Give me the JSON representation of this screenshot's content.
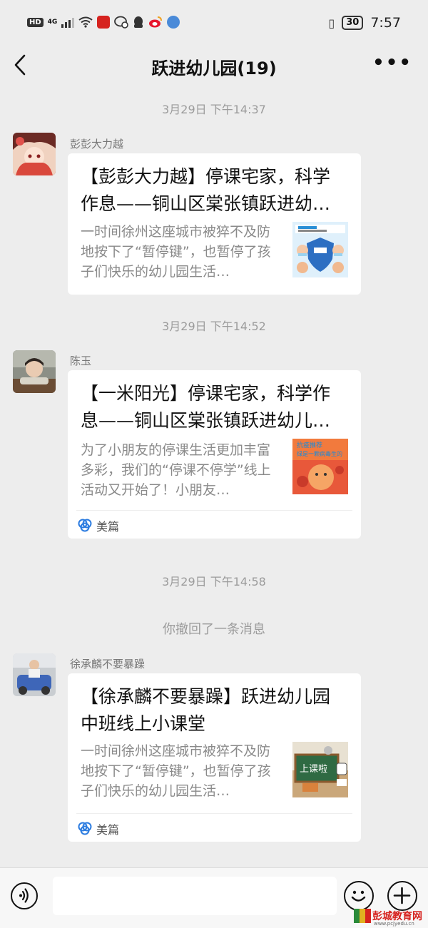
{
  "status_bar": {
    "hd": "HD",
    "network": "4G",
    "battery": "30",
    "time": "7:57"
  },
  "nav": {
    "title": "跃进幼儿园(19)",
    "more": "•••"
  },
  "timestamps": [
    "3月29日 下午14:37",
    "3月29日 下午14:52",
    "3月29日 下午14:58"
  ],
  "recall_notice": "你撤回了一条消息",
  "messages": [
    {
      "sender": "彭彭大力越",
      "title": "【彭彭大力越】停课宅家，科学作息——铜山区棠张镇跃进幼…",
      "desc": "一时间徐州这座城市被猝不及防地按下了“暂停键”，也暂停了孩子们快乐的幼儿园生活…",
      "source": ""
    },
    {
      "sender": "陈玉",
      "title": "【一米阳光】停课宅家，科学作息——铜山区棠张镇跃进幼儿…",
      "desc": "为了小朋友的停课生活更加丰富多彩，我们的“停课不停学”线上活动又开始了！小朋友…",
      "source": "美篇"
    },
    {
      "sender": "徐承麟不要暴躁",
      "title": "【徐承麟不要暴躁】跃进幼儿园中班线上小课堂",
      "desc": "一时间徐州这座城市被猝不及防地按下了“暂停键”，也暂停了孩子们快乐的幼儿园生活…",
      "source": "美篇"
    }
  ],
  "thumb_text": {
    "t2_line1": "抗疫推荐",
    "t2_line2": "绿是一颗病毒生的",
    "t3": "上课啦"
  },
  "watermark": {
    "name": "彭城教育网",
    "url": "www.pcjyedu.cn"
  },
  "colors": {
    "background": "#ededed",
    "card": "#ffffff",
    "meta_text": "#9b9b9b",
    "watermark": "#d6231f"
  }
}
